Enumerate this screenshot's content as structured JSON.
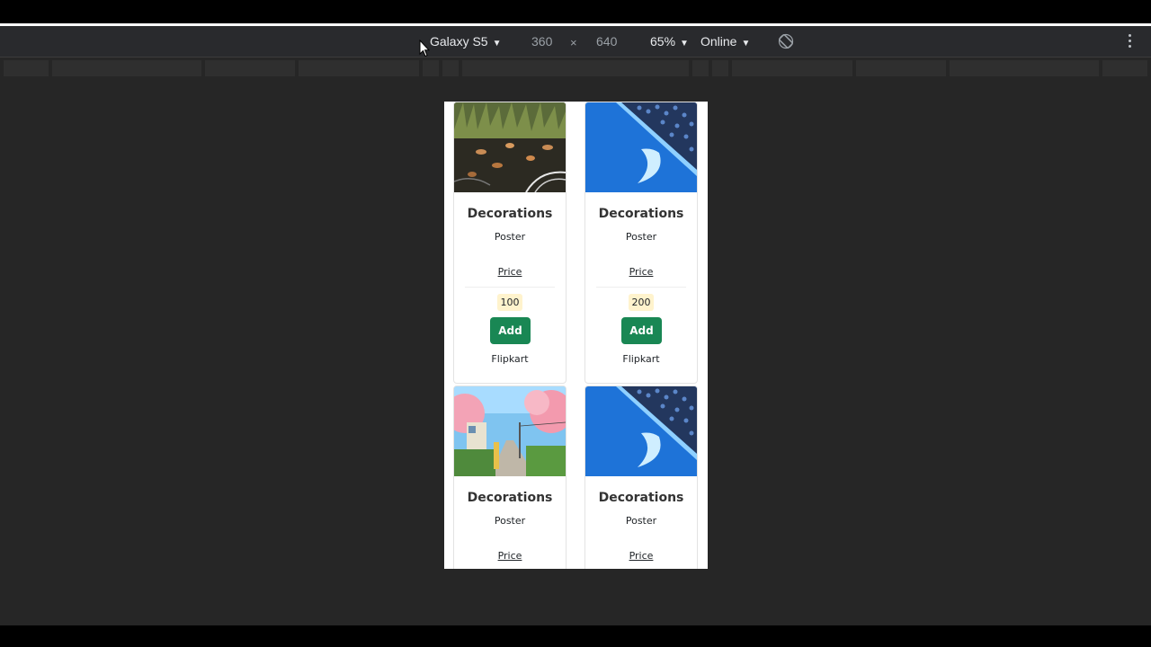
{
  "devtools": {
    "device_name": "Galaxy S5",
    "width": "360",
    "times": "×",
    "height": "640",
    "zoom": "65%",
    "network": "Online",
    "caret": "▼"
  },
  "cards": [
    {
      "title": "Decorations",
      "subtitle": "Poster",
      "price_label": "Price",
      "price": "100",
      "button": "Add",
      "store": "Flipkart"
    },
    {
      "title": "Decorations",
      "subtitle": "Poster",
      "price_label": "Price",
      "price": "200",
      "button": "Add",
      "store": "Flipkart"
    },
    {
      "title": "Decorations",
      "subtitle": "Poster",
      "price_label": "Price",
      "price": "",
      "button": "",
      "store": ""
    },
    {
      "title": "Decorations",
      "subtitle": "Poster",
      "price_label": "Price",
      "price": "",
      "button": "",
      "store": ""
    }
  ],
  "colors": {
    "button": "#198754",
    "price_badge": "#fff3cd",
    "toolbar_bg": "#292a2d",
    "viewport_bg": "#262626"
  }
}
